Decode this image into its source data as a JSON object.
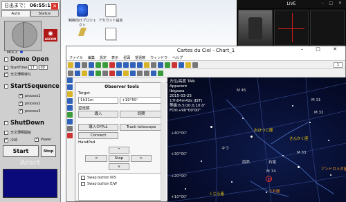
{
  "clock": {
    "label": "日出まで：",
    "time": "06:55:11"
  },
  "panel": {
    "tabs": [
      "Auto",
      "Status"
    ],
    "moc_label": "MOC3",
    "ascom": "ASCOM",
    "dome_open": "Dome Open",
    "start_time_label": "StartTime",
    "start_hour": "17",
    "start_min": "00",
    "weather_label": "天文薄明待ち",
    "start_sequence": "StartSequence",
    "processes": [
      "process1",
      "process2",
      "process3"
    ],
    "shutdown": "ShutDown",
    "opt_twilight": "天文薄明開始",
    "opt_cooling": "冷却",
    "opt_power": "Power",
    "start_button": "Start",
    "stop_button": "Stop",
    "footer": "Arart"
  },
  "desktop_icons": [
    {
      "label": "制御向けプロジェクト"
    },
    {
      "label": "アカウント設定"
    }
  ],
  "live": {
    "title": "LIVE"
  },
  "cdc": {
    "title": "Cartes du Ciel - Chart_1",
    "menu": [
      "ファイル",
      "編集",
      "設定",
      "表示",
      "星図",
      "望遠鏡",
      "ウィンドウ",
      "ヘルプ"
    ],
    "zoom": "1"
  },
  "observer": {
    "title": "Observer tools",
    "f1": "F1",
    "target_label": "Target",
    "ra": "1h31m",
    "dec": "+19°50'",
    "telescope_label": "望遠鏡",
    "btn_slew": "導入",
    "btn_sync": "同期",
    "btn_abort": "導入の中止",
    "btn_track": "Track telescope",
    "btn_connect": "Connect",
    "handpad": "HandPad",
    "arrow_up": "^",
    "arrow_left": "<",
    "btn_stop": "Stop",
    "arrow_right": ">",
    "arrow_down": "v",
    "swap_ns": "Swap button N/S",
    "swap_ew": "Swap button E/W"
  },
  "sky": {
    "info": [
      "方位/高度 TAN",
      "Apparent",
      "Ibigawa",
      "2015-03-25",
      "17h04m42s (JST)",
      "等級:6.5/10.0,10.0'",
      "FOV:+90°00'00\""
    ],
    "labels": {
      "m45": "M 45",
      "m31": "M 31",
      "m32": "M 32",
      "m33": "M 33",
      "m74": "M 74",
      "ohitsuji": "おひつじ座",
      "sankaku": "さんかく座",
      "andromeda": "アンドロメダ座",
      "kujira": "くじら座",
      "uo": "うお座",
      "dec40": "+40°00'",
      "dec30": "+30°00'",
      "dec20": "+20°00'",
      "dec10": "+10°00'",
      "star_kiu": "キウ",
      "star_nanasho": "南昴",
      "star_seki": "石尾"
    }
  }
}
